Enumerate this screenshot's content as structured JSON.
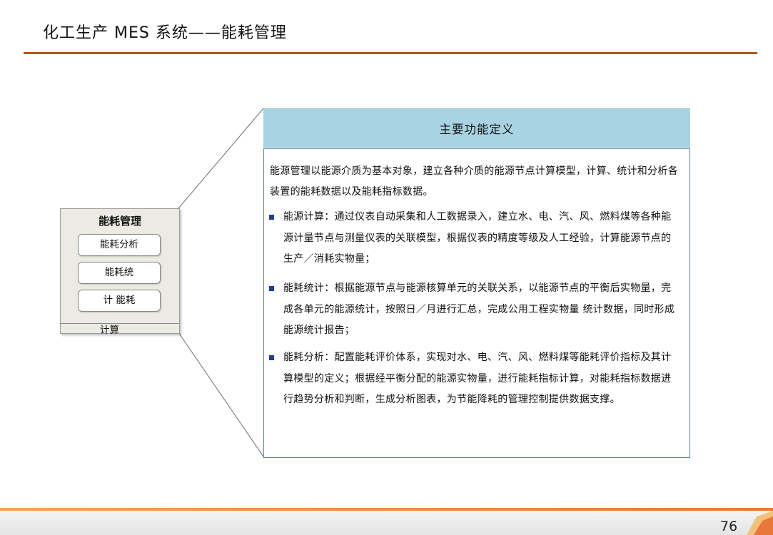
{
  "header": {
    "title": "化工生产 MES 系统——能耗管理"
  },
  "module": {
    "title": "能耗管理",
    "items": [
      "能耗分析",
      "能耗统",
      "计 能耗"
    ],
    "overflow_text": "计算"
  },
  "panel": {
    "heading": "主要功能定义",
    "intro": "能源管理以能源介质为基本对象，建立各种介质的能源节点计算模型，计算、统计和分析各装置的能耗数据以及能耗指标数据。",
    "bullets": [
      "能源计算：通过仪表自动采集和人工数据录入，建立水、电、汽、风、燃料煤等各种能源计量节点与测量仪表的关联模型，根据仪表的精度等级及人工经验，计算能源节点的生产／消耗实物量；",
      "能耗统计：根据能源节点与能源核算单元的关联关系，以能源节点的平衡后实物量，完成各单元的能源统计，按照日／月进行汇总，完成公用工程实物量 统计数据，同时形成能源统计报告；",
      "能耗分析：配置能耗评价体系，实现对水、电、汽、风、燃料煤等能耗评价指标及其计算模型的定义；根据经平衡分配的能源实物量，进行能耗指标计算，对能耗指标数据进行趋势分析和判断，生成分析图表，为节能降耗的管理控制提供数据支撑。"
    ]
  },
  "footer": {
    "page_number": "76"
  },
  "colors": {
    "title_rule": "#b5541f",
    "panel_heading_bg": "#a9d3e3",
    "panel_border": "#5b7fb0",
    "module_bg": "#ecebe3",
    "bullet": "#1f3f8a",
    "footer_accent": "#e9773a"
  }
}
